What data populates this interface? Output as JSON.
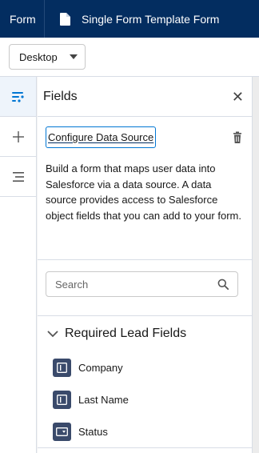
{
  "topbar": {
    "app_label": "Form",
    "doc_title": "Single Form Template Form",
    "doc_icon": "document-icon"
  },
  "toolbar": {
    "device_selected": "Desktop"
  },
  "rail": {
    "items": [
      {
        "icon": "fields-list-icon",
        "active": true
      },
      {
        "icon": "add-icon",
        "active": false
      },
      {
        "icon": "layers-icon",
        "active": false
      }
    ]
  },
  "panel": {
    "title": "Fields",
    "configure_label": "Configure Data Source",
    "description": "Build a form that maps user data into Salesforce via a data source. A data source provides access to Salesforce object fields that you can add to your form.",
    "search_placeholder": "Search",
    "group_title": "Required Lead Fields",
    "fields": [
      {
        "label": "Company",
        "icon": "text-field-icon"
      },
      {
        "label": "Last Name",
        "icon": "text-field-icon"
      },
      {
        "label": "Status",
        "icon": "picklist-icon"
      }
    ]
  },
  "colors": {
    "brand_navy": "#032d60",
    "accent_blue": "#0176d3",
    "field_icon_bg": "#3a4a6b"
  }
}
